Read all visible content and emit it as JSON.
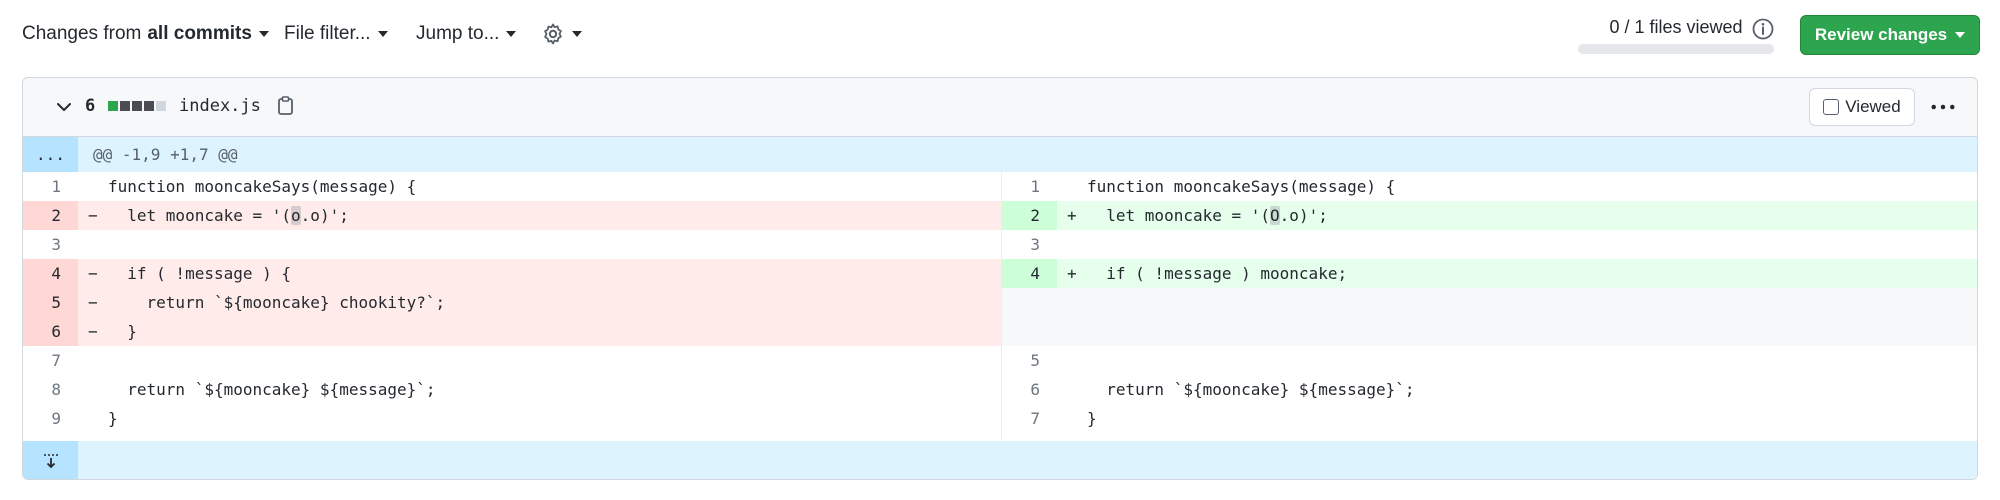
{
  "toolbar": {
    "changes_prefix": "Changes from",
    "changes_scope": "all commits",
    "file_filter": "File filter...",
    "jump_to": "Jump to...",
    "files_viewed": "0 / 1 files viewed",
    "files_viewed_progress": 0,
    "review_button": "Review changes"
  },
  "file": {
    "change_count": "6",
    "name": "index.js",
    "diffstat_colors": [
      "#2da44e",
      "#4b4d52",
      "#4b4d52",
      "#4b4d52",
      "#d0d7de"
    ],
    "viewed_label": "Viewed",
    "hunk_header": "@@ -1,9 +1,7 @@",
    "expander_label": "..."
  },
  "left_rows": [
    {
      "num": "1",
      "sign": "",
      "type": "ctx",
      "code": "function mooncakeSays(message) {"
    },
    {
      "num": "2",
      "sign": "−",
      "type": "del",
      "code_pre": "  let mooncake = '(",
      "code_hl": "o",
      "code_post": ".o)';"
    },
    {
      "num": "3",
      "sign": "",
      "type": "ctx",
      "code": ""
    },
    {
      "num": "4",
      "sign": "−",
      "type": "del",
      "code": "  if ( !message ) {"
    },
    {
      "num": "5",
      "sign": "−",
      "type": "del",
      "code": "    return `${mooncake} chookity?`;"
    },
    {
      "num": "6",
      "sign": "−",
      "type": "del",
      "code": "  }"
    },
    {
      "num": "7",
      "sign": "",
      "type": "ctx",
      "code": ""
    },
    {
      "num": "8",
      "sign": "",
      "type": "ctx",
      "code": "  return `${mooncake} ${message}`;"
    },
    {
      "num": "9",
      "sign": "",
      "type": "ctx",
      "code": "}"
    }
  ],
  "right_rows": [
    {
      "num": "1",
      "sign": "",
      "type": "ctx",
      "code": "function mooncakeSays(message) {"
    },
    {
      "num": "2",
      "sign": "+",
      "type": "add",
      "code_pre": "  let mooncake = '(",
      "code_hl": "O",
      "code_post": ".o)';"
    },
    {
      "num": "3",
      "sign": "",
      "type": "ctx",
      "code": ""
    },
    {
      "num": "4",
      "sign": "+",
      "type": "add",
      "code": "  if ( !message ) mooncake;"
    },
    {
      "num": "",
      "sign": "",
      "type": "empty",
      "code": ""
    },
    {
      "num": "",
      "sign": "",
      "type": "empty",
      "code": ""
    },
    {
      "num": "5",
      "sign": "",
      "type": "ctx",
      "code": ""
    },
    {
      "num": "6",
      "sign": "",
      "type": "ctx",
      "code": "  return `${mooncake} ${message}`;"
    },
    {
      "num": "7",
      "sign": "",
      "type": "ctx",
      "code": "}"
    }
  ],
  "icons": {
    "gear": "gear-icon",
    "info": "info-icon",
    "chevron": "chevron-down-icon",
    "copy": "copy-icon",
    "more": "kebab-horizontal-icon",
    "expand_up": "unfold-icon",
    "expand_down": "expand-down-icon"
  }
}
